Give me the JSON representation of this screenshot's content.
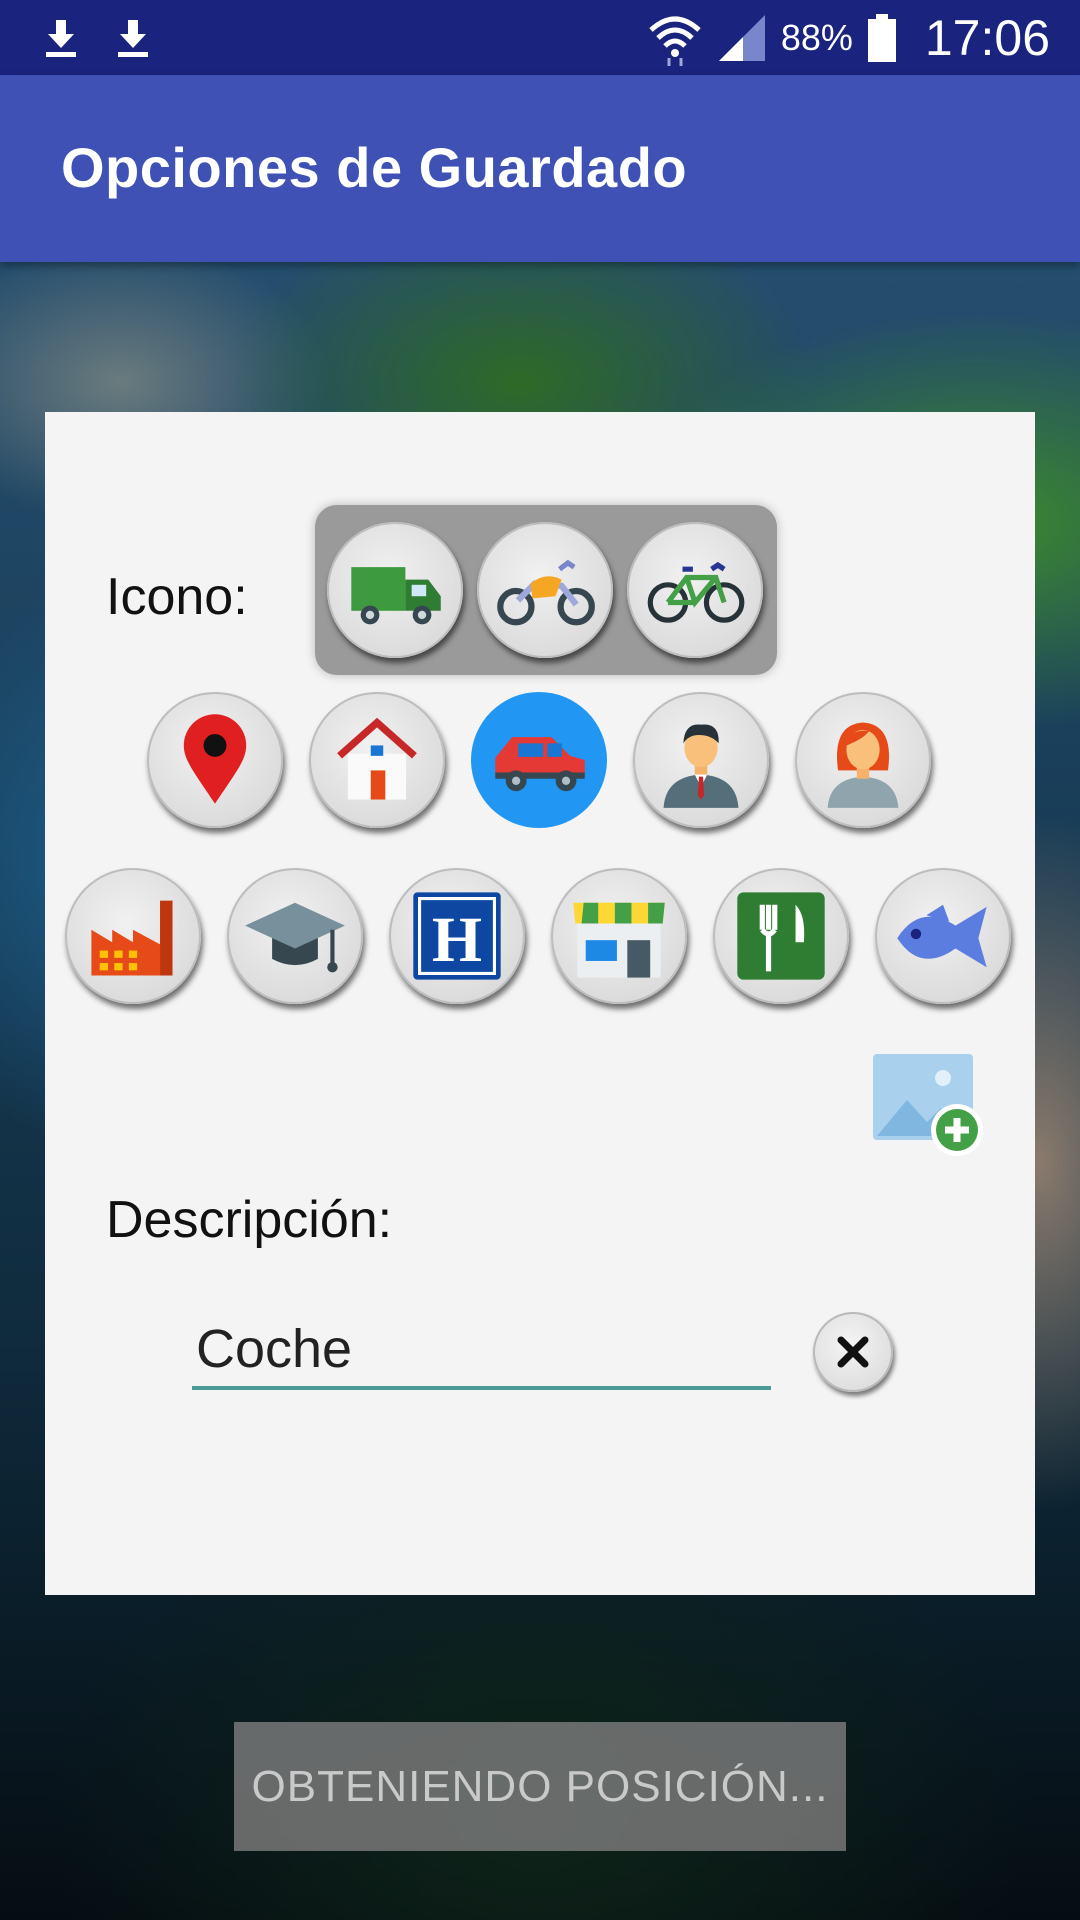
{
  "status_bar": {
    "icons": [
      "download-icon",
      "download-icon",
      "wifi-icon",
      "signal-icon",
      "battery-icon"
    ],
    "battery": "88%",
    "time": "17:06"
  },
  "app_bar": {
    "title": "Opciones de Guardado"
  },
  "dialog": {
    "icon_label": "Icono:",
    "vehicle_icons": [
      "truck-icon",
      "motorcycle-icon",
      "bicycle-icon"
    ],
    "icons_row1": [
      "map-pin-icon",
      "house-icon",
      "car-icon",
      "man-icon",
      "woman-icon"
    ],
    "selected_icon": "car-icon",
    "icons_row2": [
      "factory-icon",
      "graduation-cap-icon",
      "hotel-icon",
      "shop-icon",
      "restaurant-icon",
      "fish-icon"
    ],
    "add_image_icon": "add-image-icon",
    "description_label": "Descripción:",
    "description_value": "Coche",
    "clear_icon": "close-icon",
    "colors": {
      "selected": "#2196f3",
      "input_underline": "#4a9a98"
    }
  },
  "bottom_button": {
    "label": "OBTENIENDO POSICIÓN..."
  },
  "colors": {
    "status_bar": "#1a237e",
    "app_bar": "#3f51b5"
  }
}
